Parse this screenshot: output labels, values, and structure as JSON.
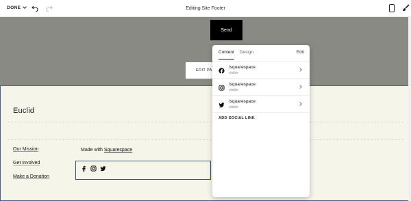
{
  "toolbar": {
    "done_label": "DONE",
    "title": "Editing Site Footer"
  },
  "canvas": {
    "send_label": "Send",
    "edit_page_label": "EDIT PAGE"
  },
  "footer": {
    "brand": "Euclid",
    "links": [
      "Our Mission",
      "Get Involved",
      "Make a Donation"
    ],
    "made_with_prefix": "Made with ",
    "made_with_link": "Squarespace"
  },
  "panel": {
    "tabs": [
      "Content",
      "Design"
    ],
    "active_tab": "Content",
    "edit_label": "Edit",
    "social_links": [
      {
        "icon": "facebook-icon",
        "handle": "/squarespace",
        "status": "visible"
      },
      {
        "icon": "instagram-icon",
        "handle": "/squarespace",
        "status": "visible"
      },
      {
        "icon": "twitter-icon",
        "handle": "/squarespace",
        "status": "visible"
      }
    ],
    "add_label": "ADD SOCIAL LINK"
  },
  "colors": {
    "footer_bg": "#f5f5ea",
    "canvas_grey": "#8a8a85",
    "selection_border": "#3b4c8a"
  }
}
